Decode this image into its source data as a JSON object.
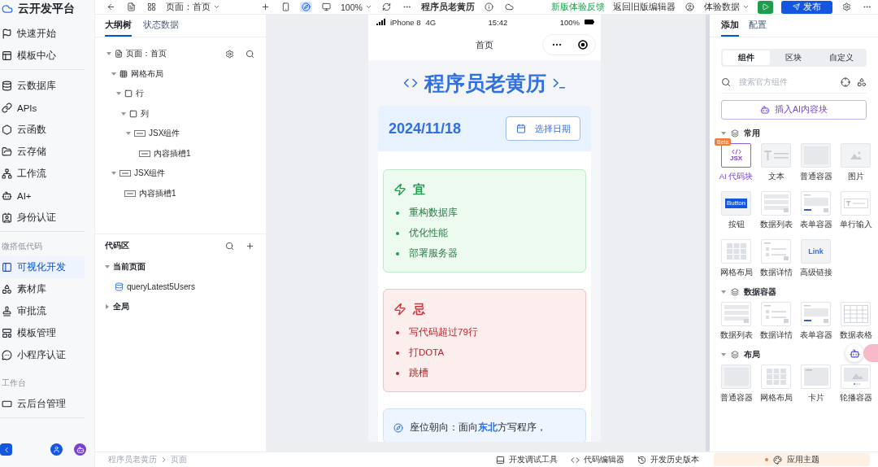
{
  "nav": {
    "title": "云开发平台",
    "groups": [
      {
        "items": [
          {
            "label": "快速开始",
            "selected": false
          },
          {
            "label": "模板中心",
            "selected": false
          }
        ]
      },
      {
        "items": [
          {
            "label": "云数据库",
            "selected": false
          },
          {
            "label": "APIs",
            "selected": false
          },
          {
            "label": "云函数",
            "selected": false
          },
          {
            "label": "云存储",
            "selected": false
          },
          {
            "label": "工作流",
            "selected": false
          },
          {
            "label": "AI+",
            "selected": false
          },
          {
            "label": "身份认证",
            "selected": false
          }
        ]
      },
      {
        "heading": "微搭低代码",
        "items": [
          {
            "label": "可视化开发",
            "selected": true
          },
          {
            "label": "素材库",
            "selected": false
          },
          {
            "label": "审批流",
            "selected": false
          },
          {
            "label": "模板管理",
            "selected": false
          },
          {
            "label": "小程序认证",
            "selected": false
          }
        ]
      },
      {
        "heading": "工作台",
        "items": [
          {
            "label": "云后台管理",
            "selected": false
          }
        ]
      }
    ]
  },
  "toolbar": {
    "page_select": "页面：首页",
    "zoom": "100%",
    "app_title": "程序员老黄历",
    "feedback_link": "新版体验反馈",
    "old_editor_link": "返回旧版编辑器",
    "data_select": "体验数据",
    "publish": "发布"
  },
  "outline": {
    "tabs": [
      {
        "label": "大纲树",
        "selected": true
      },
      {
        "label": "状态数据",
        "selected": false
      }
    ],
    "tree": [
      {
        "label": "页面：首页",
        "kind": "page",
        "expanded": true,
        "children": [
          {
            "label": "网格布局",
            "kind": "grid",
            "expanded": true,
            "children": [
              {
                "label": "行",
                "kind": "box",
                "expanded": true,
                "children": [
                  {
                    "label": "列",
                    "kind": "box",
                    "expanded": true,
                    "children": [
                      {
                        "label": "JSX组件",
                        "kind": "jsx",
                        "expanded": true,
                        "children": [
                          {
                            "label": "内容插槽1",
                            "kind": "jsx"
                          }
                        ]
                      }
                    ]
                  }
                ]
              }
            ]
          },
          {
            "label": "JSX组件",
            "kind": "jsx",
            "expanded": true,
            "children": [
              {
                "label": "内容插槽1",
                "kind": "jsx"
              }
            ]
          }
        ]
      }
    ],
    "code_title": "代码区",
    "code_tree": [
      {
        "label": "当前页面",
        "expanded": true,
        "children": [
          {
            "label": "queryLatest5Users"
          }
        ]
      },
      {
        "label": "全局",
        "expanded": false
      }
    ],
    "breadcrumb": [
      "程序员老黄历",
      "页面"
    ]
  },
  "phone": {
    "status": {
      "device": "iPhone 8",
      "network": "4G",
      "time": "15:42",
      "battery": "100%"
    },
    "nav_title": "首页",
    "heading": "程序员老黄历",
    "date": "2024/11/18",
    "date_button": "选择日期",
    "cards": [
      {
        "kind": "good",
        "title": "宜",
        "items": [
          "重构数据库",
          "优化性能",
          "部署服务器"
        ]
      },
      {
        "kind": "bad",
        "title": "忌",
        "items": [
          "写代码超过79行",
          "打DOTA",
          "跳槽"
        ]
      },
      {
        "kind": "tip",
        "text": "座位朝向：面向**东北**方写程序，"
      }
    ]
  },
  "panel": {
    "tabs": [
      {
        "label": "添加",
        "selected": true
      },
      {
        "label": "配置",
        "selected": false
      }
    ],
    "segments": [
      {
        "label": "组件",
        "selected": true
      },
      {
        "label": "区块",
        "selected": false
      },
      {
        "label": "自定义",
        "selected": false
      }
    ],
    "search": {
      "placeholder": "搜索官方组件"
    },
    "ai_button": "插入AI内容块",
    "sections": [
      {
        "title": "常用",
        "expanded": true,
        "items": [
          {
            "label": "AI 代码块",
            "kind": "jsx",
            "thumb_text": "JSX",
            "badge": "Beta"
          },
          {
            "label": "文本",
            "kind": "text"
          },
          {
            "label": "普通容器",
            "kind": "container"
          },
          {
            "label": "图片",
            "kind": "image"
          },
          {
            "label": "按钮",
            "kind": "button",
            "thumb_text": "Button"
          },
          {
            "label": "数据列表",
            "kind": "list"
          },
          {
            "label": "表单容器",
            "kind": "form"
          },
          {
            "label": "单行输入",
            "kind": "input"
          },
          {
            "label": "网格布局",
            "kind": "grid"
          },
          {
            "label": "数据详情",
            "kind": "detail"
          },
          {
            "label": "高级链接",
            "kind": "link",
            "thumb_text": "Link"
          }
        ]
      },
      {
        "title": "数据容器",
        "expanded": true,
        "items": [
          {
            "label": "数据列表",
            "kind": "list"
          },
          {
            "label": "数据详情",
            "kind": "detail"
          },
          {
            "label": "表单容器",
            "kind": "form"
          },
          {
            "label": "数据表格",
            "kind": "table"
          }
        ]
      },
      {
        "title": "布局",
        "expanded": true,
        "items": [
          {
            "label": "普通容器",
            "kind": "container"
          },
          {
            "label": "网格布局",
            "kind": "grid"
          },
          {
            "label": "卡片",
            "kind": "card"
          },
          {
            "label": "轮播容器",
            "kind": "carousel"
          }
        ]
      }
    ],
    "theme_button": "应用主题"
  },
  "bottom_tools": [
    "开发调试工具",
    "代码编辑器",
    "开发历史版本"
  ]
}
